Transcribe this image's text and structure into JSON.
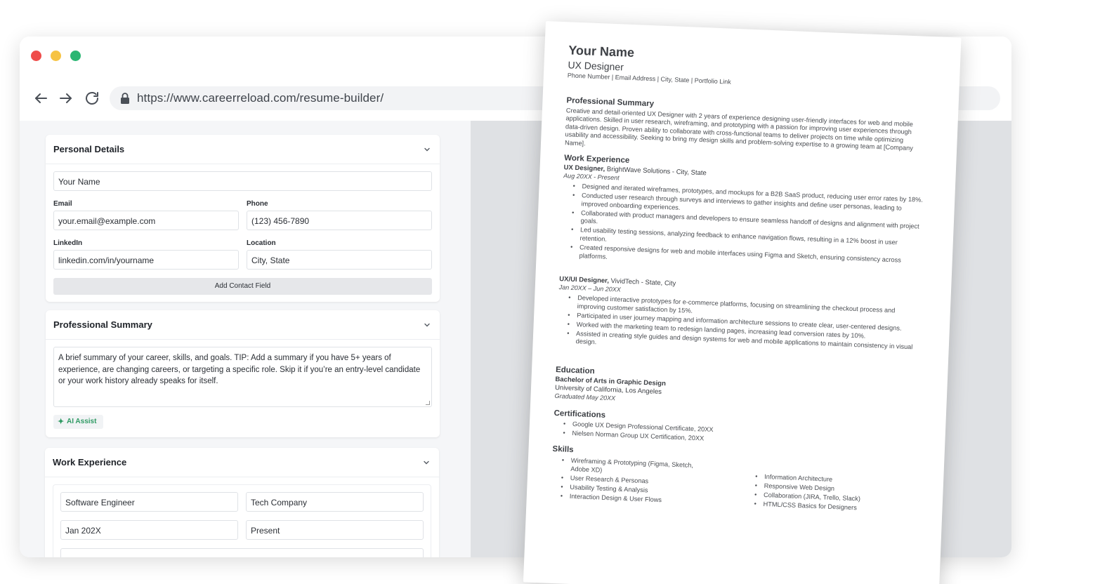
{
  "browser": {
    "url": "https://www.careerreload.com/resume-builder/"
  },
  "personal": {
    "title": "Personal Details",
    "name_value": "Your Name",
    "email_label": "Email",
    "email_value": "your.email@example.com",
    "phone_label": "Phone",
    "phone_value": "(123) 456-7890",
    "linkedin_label": "LinkedIn",
    "linkedin_value": "linkedin.com/in/yourname",
    "location_label": "Location",
    "location_value": "City, State",
    "add_field_label": "Add Contact Field"
  },
  "summary": {
    "title": "Professional Summary",
    "text": "A brief summary of your career, skills, and goals. TIP: Add a summary if you have 5+ years of experience, are changing careers, or targeting a specific role. Skip it if you’re an entry-level candidate or your work history already speaks for itself.",
    "ai_label": "AI Assist"
  },
  "work": {
    "title": "Work Experience",
    "job_title": "Software Engineer",
    "company": "Tech Company",
    "start": "Jan 202X",
    "end": "Present"
  },
  "resume": {
    "name": "Your Name",
    "role": "UX Designer",
    "contact": "Phone Number | Email Address | City, State | Portfolio Link",
    "summary_heading": "Professional Summary",
    "summary_text": "Creative and detail-oriented UX Designer with 2 years of experience designing user-friendly interfaces for web and mobile applications. Skilled in user research, wireframing, and prototyping with a passion for improving user experiences through data-driven design. Proven ability to collaborate with cross-functional teams to deliver projects on time while optimizing usability and accessibility. Seeking to bring my design skills and problem-solving expertise to a growing team at [Company Name].",
    "work_heading": "Work Experience",
    "job1_title": "UX Designer,",
    "job1_company": " BrightWave Solutions - City, State",
    "job1_dates": "Aug 20XX - Present",
    "job1_bullets": [
      "Designed and iterated wireframes, prototypes, and mockups for a B2B SaaS product, reducing user error rates by 18%.",
      "Conducted user research through surveys and interviews to gather insights and define user personas, leading to improved onboarding experiences.",
      "Collaborated with product managers and developers to ensure seamless handoff of designs and alignment with project goals.",
      "Led usability testing sessions, analyzing feedback to enhance navigation flows, resulting in a 12% boost in user retention.",
      "Created responsive designs for web and mobile interfaces using Figma and Sketch, ensuring consistency across platforms."
    ],
    "job2_title": "UX/UI Designer,",
    "job2_company": "  VividTech - State, City",
    "job2_dates": "Jan 20XX – Jun 20XX",
    "job2_bullets": [
      "Developed interactive prototypes for e-commerce platforms, focusing on streamlining the checkout process and improving customer satisfaction by 15%.",
      "Participated in user journey mapping and information architecture sessions to create clear, user-centered designs.",
      "Worked with the marketing team to redesign landing pages, increasing lead conversion rates by 10%.",
      "Assisted in creating style guides and design systems for web and mobile applications to maintain consistency in visual design."
    ],
    "edu_heading": "Education",
    "edu_degree": "Bachelor of Arts in Graphic Design",
    "edu_school": "University of California, Los Angeles",
    "edu_date": "Graduated May 20XX",
    "cert_heading": "Certifications",
    "certs": [
      "Google UX Design Professional Certificate, 20XX",
      "Nielsen Norman Group UX Certification, 20XX"
    ],
    "skills_heading": "Skills",
    "skills_left": [
      "Wireframing & Prototyping (Figma, Sketch, Adobe XD)",
      "User Research & Personas",
      "Usability Testing & Analysis",
      "Interaction Design & User Flows"
    ],
    "skills_right": [
      "Information Architecture",
      "Responsive Web Design",
      "Collaboration (JIRA, Trello, Slack)",
      "HTML/CSS Basics for Designers"
    ]
  }
}
